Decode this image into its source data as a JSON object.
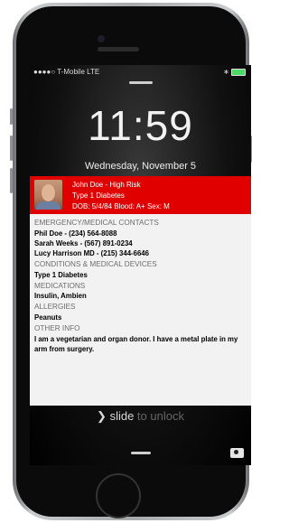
{
  "status_bar": {
    "carrier": "●●●●○ T-Mobile LTE",
    "bluetooth": "∗"
  },
  "lock_screen": {
    "time": "11:59",
    "date": "Wednesday, November 5",
    "slide_label": "slide",
    "slide_rest": " to unlock"
  },
  "alert": {
    "line1": "John Doe - High Risk",
    "line2": "Type 1 Diabetes",
    "line3": "DOB: 5/4/84 Blood: A+ Sex: M"
  },
  "medical": {
    "emergency_title": "EMERGENCY/MEDICAL CONTACTS",
    "contacts": [
      "Phil Doe - (234) 564-8088",
      "Sarah Weeks - (567) 891-0234",
      "Lucy Harrison MD - (215) 344-6646"
    ],
    "conditions_title": "CONDITIONS & MEDICAL DEVICES",
    "conditions": "Type 1 Diabetes",
    "medications_title": "MEDICATIONS",
    "medications": "Insulin, Ambien",
    "allergies_title": "ALLERGIES",
    "allergies": "Peanuts",
    "other_title": "OTHER INFO",
    "other": "I am a vegetarian and organ donor. I have a metal plate in my arm from surgery."
  }
}
